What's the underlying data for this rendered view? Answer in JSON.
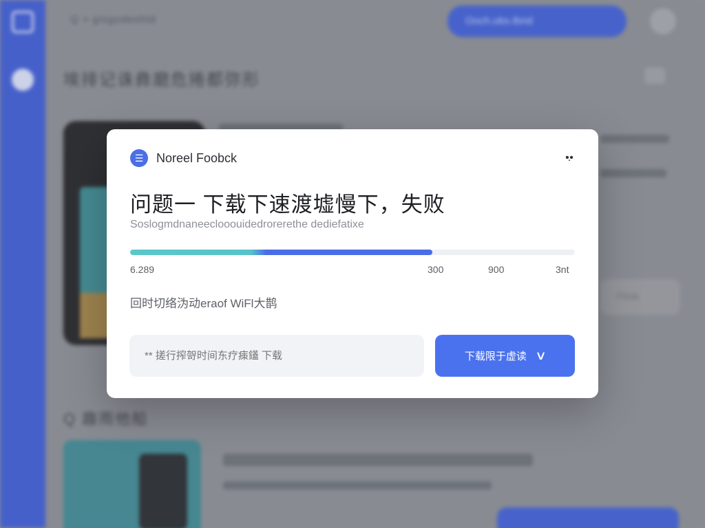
{
  "background": {
    "breadcrumb": "Q  >  gisgodeshtd",
    "top_button_label": "Ooch.ubs.tbnd",
    "section1_title": "埃排记诛彝磨危捲都弥形",
    "ghost_button_label": "Fbsk",
    "section2_title": "Q 趣雨他船",
    "colors": {
      "sidebar": "#3b5bdb",
      "primary": "#3c5fdc"
    }
  },
  "modal": {
    "brand_icon": "menu-lines-icon",
    "brand_name": "Noreel Foobck",
    "close_icon": "close-dots-icon",
    "close_glyph": "•.•",
    "title": "问题一  下载下速渡墟慢下，失败",
    "subtitle": "Soslogmdnaneeclooouidedrorerethe dediefatixe",
    "progress": {
      "value_percent": 68,
      "start_label": "6.289",
      "tick_labels": [
        "300",
        "900",
        "3nt"
      ]
    },
    "hint": "回时切络沩动eraof WiFl大鹊",
    "input": {
      "value": "",
      "placeholder": "** 搓行搾哿时间东疗㾊鑉 下载"
    },
    "primary_button": {
      "label": "下载限于虚读",
      "icon": "chevron-down-icon",
      "icon_glyph": "∨"
    },
    "colors": {
      "primary": "#4a72ee",
      "progress_teal": "#5bc7c8",
      "progress_blue": "#4a6ee8"
    }
  }
}
